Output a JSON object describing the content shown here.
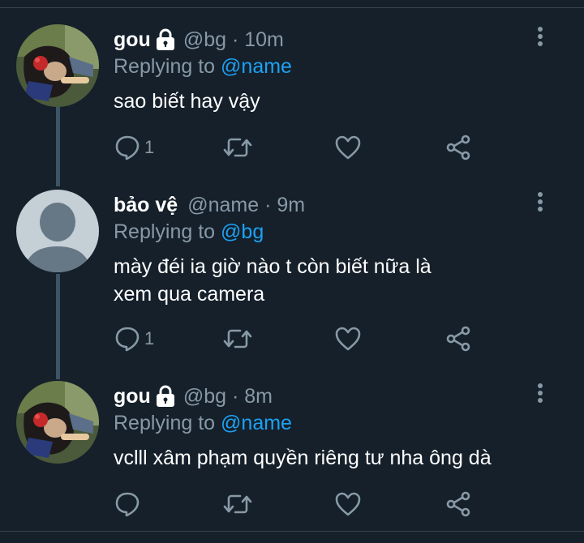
{
  "tweets": [
    {
      "author": "gou",
      "protected": true,
      "handle_time": "@bg · 10m",
      "replying_prefix": "Replying to ",
      "replying_to": "@name",
      "text_lines": [
        "sao biết hay vậy"
      ],
      "reply_count": "1",
      "avatar": "anime-character-avatar"
    },
    {
      "author": "bảo vệ",
      "protected": false,
      "handle_time": "@name · 9m",
      "replying_prefix": "Replying to ",
      "replying_to": "@bg",
      "text_lines": [
        "mày đéi ia giờ nào t còn biết nữa là",
        "xem qua camera"
      ],
      "reply_count": "1",
      "avatar": "default-profile-avatar"
    },
    {
      "author": "gou",
      "protected": true,
      "handle_time": "@bg · 8m",
      "replying_prefix": "Replying to ",
      "replying_to": "@name",
      "text_lines": [
        "vclll xâm phạm quyền riêng tư nha ông dà"
      ],
      "reply_count": "",
      "avatar": "anime-character-avatar"
    }
  ],
  "icons": {
    "reply": "reply-icon",
    "retweet": "retweet-icon",
    "like": "heart-icon",
    "share": "share-icon",
    "more": "more-vertical-icon",
    "lock": "lock-icon"
  },
  "colors": {
    "background": "#15202b",
    "secondary_text": "#8899a6",
    "mention": "#1da1f2",
    "thread_line": "#3d5466",
    "divider": "#38444d"
  }
}
